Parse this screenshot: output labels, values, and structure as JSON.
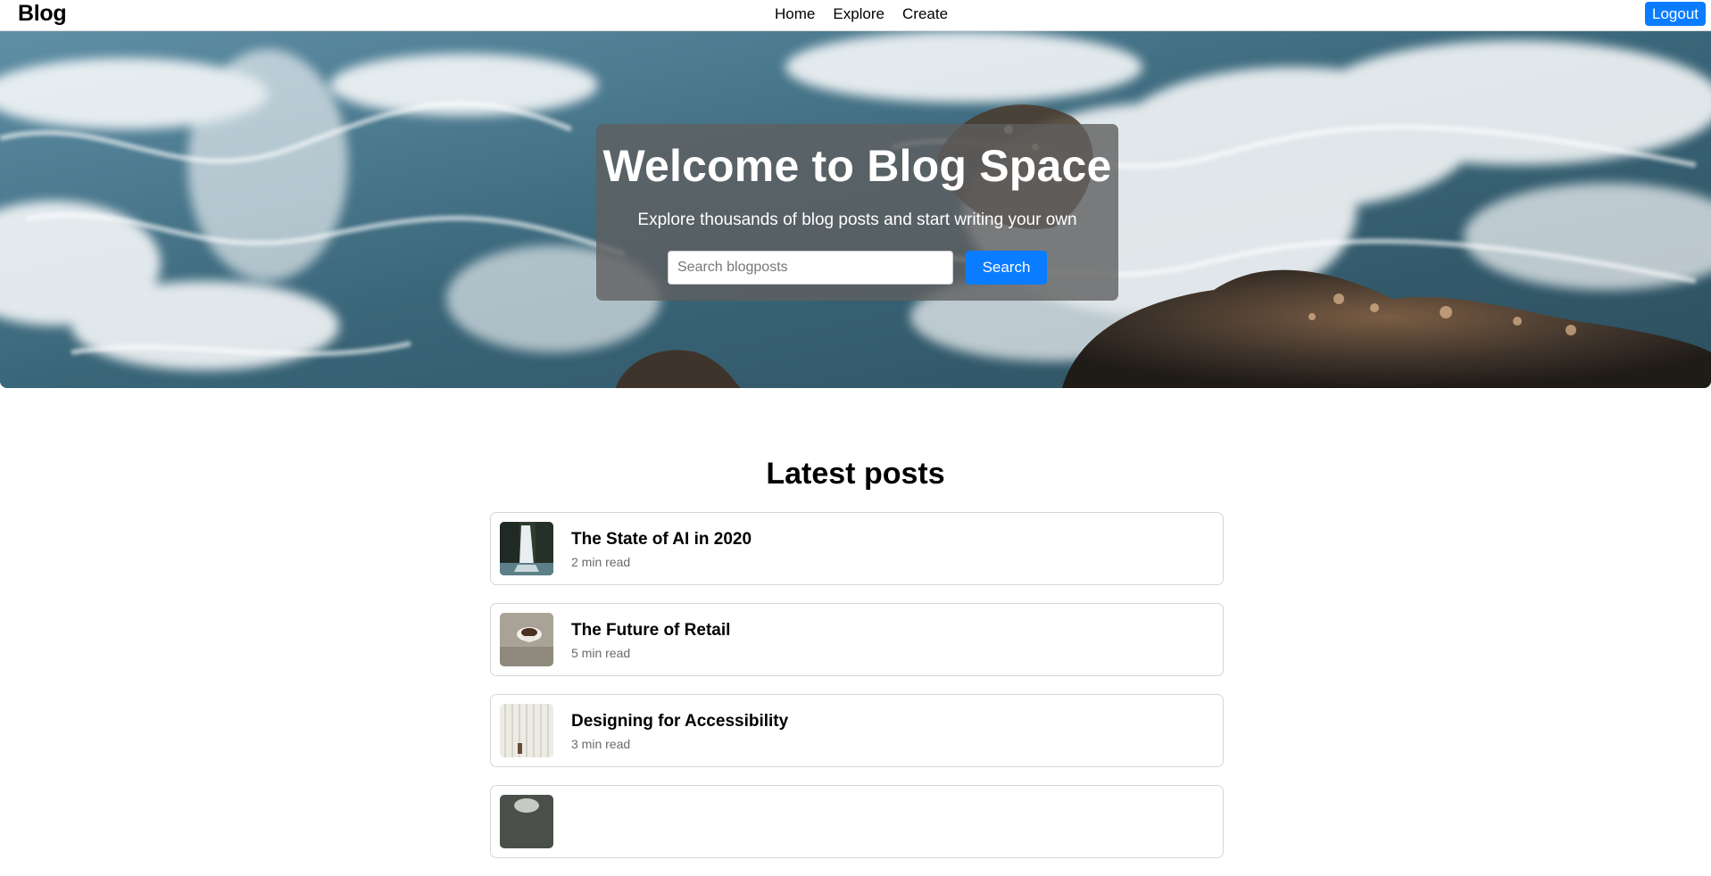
{
  "header": {
    "brand": "Blog",
    "nav": [
      {
        "label": "Home"
      },
      {
        "label": "Explore"
      },
      {
        "label": "Create"
      }
    ],
    "logout_label": "Logout"
  },
  "hero": {
    "title": "Welcome to Blog Space",
    "subtitle": "Explore thousands of blog posts and start writing your own",
    "search_placeholder": "Search blogposts",
    "search_value": "",
    "search_button": "Search"
  },
  "posts_section": {
    "title": "Latest posts",
    "posts": [
      {
        "title": "The State of AI in 2020",
        "meta": "2 min read",
        "thumb": "waterfall-image"
      },
      {
        "title": "The Future of Retail",
        "meta": "5 min read",
        "thumb": "coffee-cup-image"
      },
      {
        "title": "Designing for Accessibility",
        "meta": "3 min read",
        "thumb": "curtain-image"
      },
      {
        "title": "",
        "meta": "",
        "thumb": "rock-image"
      }
    ]
  },
  "colors": {
    "accent": "#0a7cff",
    "hero_panel": "#5f5f5f",
    "card_border": "#d6d6d6",
    "meta_text": "#6a6a6a"
  }
}
